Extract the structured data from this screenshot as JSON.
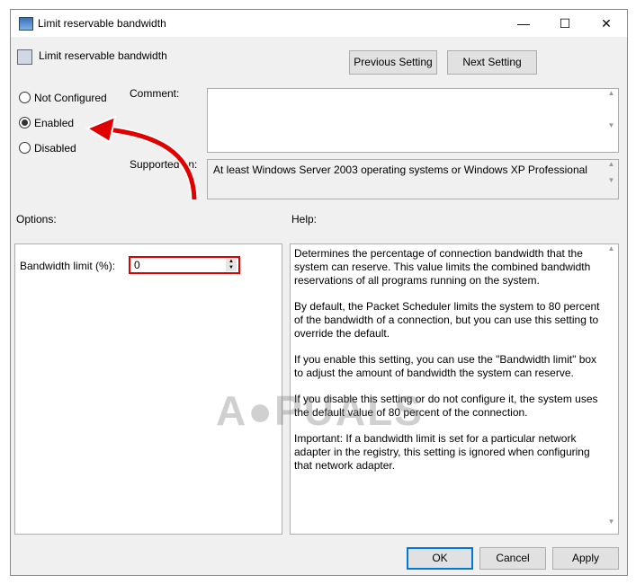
{
  "window": {
    "title": "Limit reservable bandwidth",
    "minimize": "—",
    "maximize": "☐",
    "close": "✕"
  },
  "header": {
    "setting_title": "Limit reservable bandwidth",
    "previous_label": "Previous Setting",
    "next_label": "Next Setting"
  },
  "state": {
    "options": [
      {
        "label": "Not Configured",
        "selected": false
      },
      {
        "label": "Enabled",
        "selected": true
      },
      {
        "label": "Disabled",
        "selected": false
      }
    ]
  },
  "comment": {
    "label": "Comment:",
    "value": ""
  },
  "supported": {
    "label": "Supported on:",
    "value": "At least Windows Server 2003 operating systems or Windows XP Professional"
  },
  "options": {
    "label": "Options:",
    "bandwidth_label": "Bandwidth limit (%):",
    "bandwidth_value": "0"
  },
  "help": {
    "label": "Help:",
    "paragraphs": [
      "Determines the percentage of connection bandwidth that the system can reserve. This value limits the combined bandwidth reservations of all programs running on the system.",
      "By default, the Packet Scheduler limits the system to 80 percent of the bandwidth of a connection, but you can use this setting to override the default.",
      "If you enable this setting, you can use the \"Bandwidth limit\" box to adjust the amount of bandwidth the system can reserve.",
      "If you disable this setting or do not configure it, the system uses the default value of 80 percent of the connection.",
      "Important: If a bandwidth limit is set for a particular network adapter in the registry, this setting is ignored when configuring that network adapter."
    ]
  },
  "footer": {
    "ok": "OK",
    "cancel": "Cancel",
    "apply": "Apply"
  },
  "watermark": "APPUALS",
  "colors": {
    "annotation": "#e00000",
    "accent": "#0078d7"
  }
}
